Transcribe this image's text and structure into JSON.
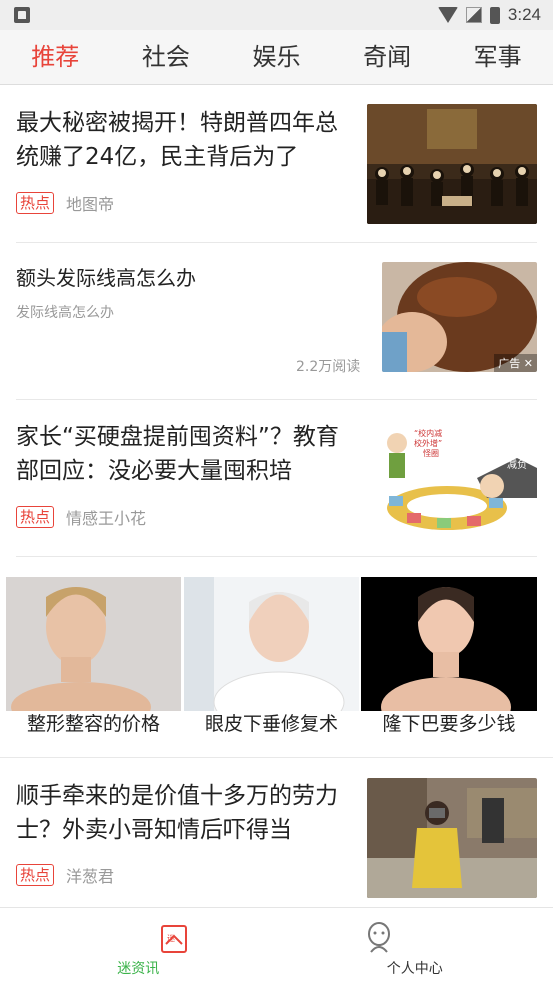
{
  "status_bar": {
    "time": "3:24"
  },
  "tabs": [
    {
      "label": "推荐",
      "active": true
    },
    {
      "label": "社会",
      "active": false
    },
    {
      "label": "娱乐",
      "active": false
    },
    {
      "label": "奇闻",
      "active": false
    },
    {
      "label": "军事",
      "active": false
    }
  ],
  "feed": {
    "item1": {
      "title": "最大秘密被揭开！特朗普四年总统赚了24亿，民主背后为了",
      "tag": "热点",
      "source": "地图帝"
    },
    "ad1": {
      "title": "额头发际线高怎么办",
      "subtitle": "发际线高怎么办",
      "reads": "2.2万阅读",
      "ad_label": "广告"
    },
    "item2": {
      "title": "家长“买硬盘提前囤资料”？教育部回应：没必要大量囤积培",
      "tag": "热点",
      "source": "情感王小花",
      "img_text_1": "“校内减",
      "img_text_2": "校外增”",
      "img_text_3": "怪圈",
      "img_text_4": "减负"
    },
    "ad2": {
      "captions": [
        "整形整容的价格",
        "眼皮下垂修复术",
        "隆下巴要多少钱"
      ]
    },
    "item3": {
      "title": "顺手牵来的是价值十多万的劳力士？外卖小哥知情后吓得当",
      "tag": "热点",
      "source": "洋葱君"
    }
  },
  "bottom_nav": [
    {
      "label": "迷资讯",
      "icon": "news-icon",
      "active": true,
      "color": "#3bb34a"
    },
    {
      "label": "个人中心",
      "icon": "person-icon",
      "active": false
    }
  ],
  "colors": {
    "accent": "#e8443a",
    "active_nav": "#3bb34a"
  }
}
